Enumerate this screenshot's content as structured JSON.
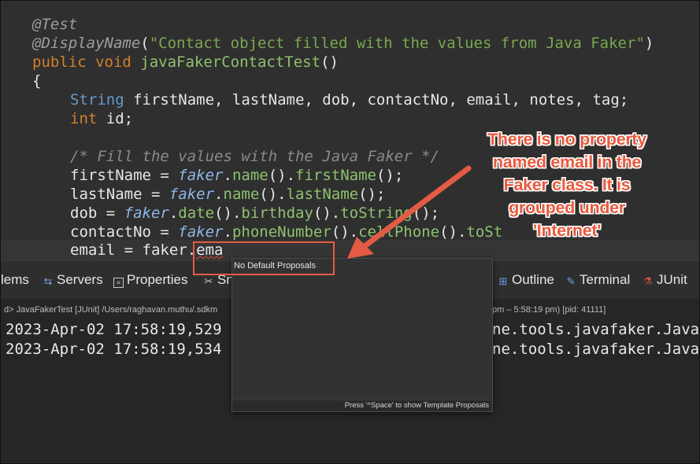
{
  "code": {
    "line1_annotation": "@Test",
    "line2_annotation": "@DisplayName",
    "line2_paren_open": "(",
    "line2_string": "\"Contact object filled with the values from Java Faker\"",
    "line2_paren_close": ")",
    "line3_kw": "public void ",
    "line3_method": "javaFakerContactTest",
    "line3_rest": "()",
    "line4_brace": "{",
    "line5_type": "String ",
    "line5_vars": "firstName, lastName, dob, contactNo, email, notes, tag;",
    "line6_kw": "int ",
    "line6_rest": "id;",
    "line7_comment": "/* Fill the values with the Java Faker */",
    "line8_lhs": "firstName = ",
    "line8_field": "faker",
    "line8_dot1": ".",
    "line8_m1": "name",
    "line8_p1": "().",
    "line8_m2": "firstName",
    "line8_end": "();",
    "line9_lhs": "lastName = ",
    "line9_field": "faker",
    "line9_dot1": ".",
    "line9_m1": "name",
    "line9_p1": "().",
    "line9_m2": "lastName",
    "line9_end": "();",
    "line10_lhs": "dob = ",
    "line10_field": "faker",
    "line10_dot1": ".",
    "line10_m1": "date",
    "line10_p1": "().",
    "line10_m2": "birthday",
    "line10_p2": "().",
    "line10_m3": "toString",
    "line10_end": "();",
    "line11_lhs": "contactNo = ",
    "line11_field": "faker",
    "line11_dot1": ".",
    "line11_m1": "phoneNumber",
    "line11_p1": "().",
    "line11_m2": "cellPhone",
    "line11_p2": "().",
    "line11_m3": "toSt",
    "line12_lhs": "email = faker.",
    "line12_typed": "ema"
  },
  "tabs": {
    "problems": "lems",
    "servers": "Servers",
    "properties": "Properties",
    "snippets": "Sn",
    "outline": "Outline",
    "terminal": "Terminal",
    "junit": "JUnit"
  },
  "console": {
    "header_left": "d> JavaFakerTest [JUnit] /Users/raghavan.muthu/.sdkm",
    "header_right": "pm – 5:58:19 pm) [pid: 41111]",
    "log1_left": "2023-Apr-02 17:58:19,529",
    "log1_right": "ne.tools.javafaker.Java",
    "log2_left": "2023-Apr-02 17:58:19,534",
    "log2_right": "ne.tools.javafaker.Java"
  },
  "popup": {
    "title": "No Default Proposals",
    "footer": "Press '^Space' to show Template Proposals"
  },
  "callout": {
    "line1": "There is no property",
    "line2": "named email in the",
    "line3": "Faker class. It is",
    "line4": "grouped under",
    "line5": "'Internet'"
  },
  "colors": {
    "callout": "#ea5a3e",
    "highlight_box": "#e35b45",
    "arrow": "#e35b45"
  }
}
